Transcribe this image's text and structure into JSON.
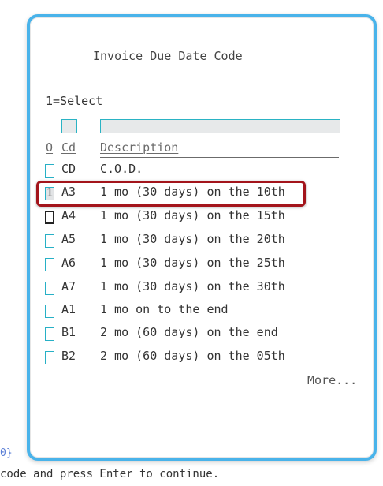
{
  "window": {
    "title": "Invoice Due Date Code",
    "instruction": "1=Select",
    "headers": {
      "option": "O",
      "code": "Cd",
      "description": "Description"
    },
    "rows": [
      {
        "opt": "",
        "cd": "CD",
        "desc": "C.O.D."
      },
      {
        "opt": "1",
        "cd": "A3",
        "desc": "1 mo (30 days) on the 10th"
      },
      {
        "opt": "",
        "cd": "A4",
        "desc": "1 mo (30 days) on the 15th"
      },
      {
        "opt": "",
        "cd": "A5",
        "desc": "1 mo (30 days) on the 20th"
      },
      {
        "opt": "",
        "cd": "A6",
        "desc": "1 mo (30 days) on the 25th"
      },
      {
        "opt": "",
        "cd": "A7",
        "desc": "1 mo (30 days) on the 30th"
      },
      {
        "opt": "",
        "cd": "A1",
        "desc": "1 mo on to the end"
      },
      {
        "opt": "",
        "cd": "B1",
        "desc": "2 mo (60 days) on the end"
      },
      {
        "opt": "",
        "cd": "B2",
        "desc": "2 mo (60 days) on the 05th"
      }
    ],
    "more": "More...",
    "accent_color": "#49b3ea",
    "highlight_color": "#a3141b"
  },
  "background": {
    "fragment": "0}",
    "message": "code and press Enter to continue."
  }
}
